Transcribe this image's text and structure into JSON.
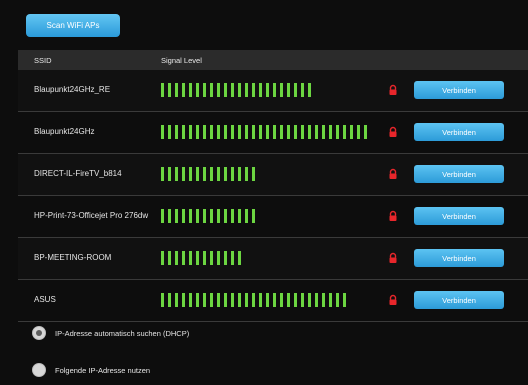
{
  "scan_button": "Scan WiFi APs",
  "table": {
    "headers": {
      "ssid": "SSID",
      "signal": "Signal Level"
    },
    "networks": [
      {
        "ssid": "Blaupunkt24GHz_RE",
        "signal_bars": 22,
        "locked": true,
        "connect_label": "Verbinden"
      },
      {
        "ssid": "Blaupunkt24GHz",
        "signal_bars": 30,
        "locked": true,
        "connect_label": "Verbinden"
      },
      {
        "ssid": "DIRECT-IL-FireTV_b814",
        "signal_bars": 14,
        "locked": true,
        "connect_label": "Verbinden"
      },
      {
        "ssid": "HP-Print-73-Officejet Pro 276dw",
        "signal_bars": 14,
        "locked": true,
        "connect_label": "Verbinden"
      },
      {
        "ssid": "BP-MEETING-ROOM",
        "signal_bars": 12,
        "locked": true,
        "connect_label": "Verbinden"
      },
      {
        "ssid": "ASUS",
        "signal_bars": 27,
        "locked": true,
        "connect_label": "Verbinden"
      }
    ]
  },
  "ip_options": [
    {
      "label": "IP-Adresse automatisch suchen (DHCP)",
      "checked": true
    },
    {
      "label": "Folgende IP-Adresse nutzen",
      "checked": false
    }
  ],
  "colors": {
    "background": "#0d0d0d",
    "signal_bar": "#6cd641",
    "lock": "#e8262b",
    "button": "#2c9bd8"
  }
}
